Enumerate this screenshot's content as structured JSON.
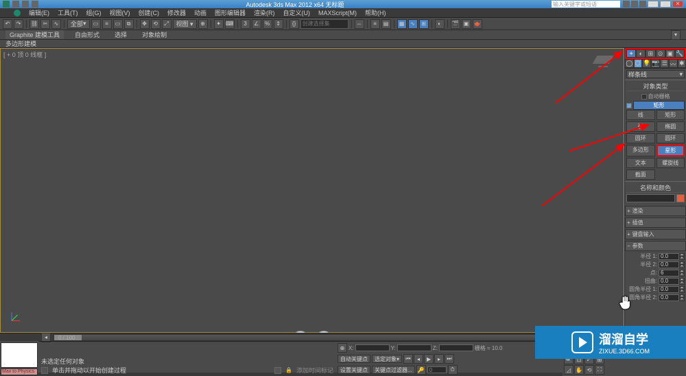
{
  "titlebar": {
    "title": "Autodesk 3ds Max  2012 x64   无标题",
    "search_placeholder": "输入关键字或短语"
  },
  "menubar": {
    "items": [
      "编辑(E)",
      "工具(T)",
      "组(G)",
      "视图(V)",
      "创建(C)",
      "修改器",
      "动画",
      "图形编辑器",
      "渲染(R)",
      "自定义(U)",
      "MAXScript(M)",
      "帮助(H)"
    ]
  },
  "toolbar": {
    "dropdown_all": "全部",
    "search_placeholder": "创建选择集"
  },
  "ribbon": {
    "tabs": [
      "Graphite 建模工具",
      "自由形式",
      "选择",
      "对象绘制"
    ]
  },
  "subribbon": {
    "label": "多边形建模"
  },
  "viewport": {
    "label": "[ + 0 顶 0 线框 ]"
  },
  "panel": {
    "dropdown": "样条线",
    "section_object_type": "对象类型",
    "autogrid": "自动栅格",
    "buttons": [
      {
        "label": "线",
        "active": false
      },
      {
        "label": "矩形",
        "active": true
      },
      {
        "label": "线",
        "active": false
      },
      {
        "label": "矩形",
        "active": false
      },
      {
        "label": "弧",
        "active": false
      },
      {
        "label": "椭圆",
        "active": false
      },
      {
        "label": "圆环",
        "active": false
      },
      {
        "label": "圆环",
        "active": false
      },
      {
        "label": "多边形",
        "active": false
      },
      {
        "label": "星形",
        "active": false,
        "hl": true
      },
      {
        "label": "文本",
        "active": false
      },
      {
        "label": "螺旋线",
        "active": false
      },
      {
        "label": "截面",
        "active": false
      }
    ],
    "section_name_color": "名称和颜色",
    "rollouts": [
      "渲染",
      "插值",
      "键盘输入"
    ],
    "params_title": "参数",
    "spinners": [
      {
        "label": "半径 1:",
        "value": "0.0"
      },
      {
        "label": "半径 2:",
        "value": "0.0"
      },
      {
        "label": "点:",
        "value": "6"
      },
      {
        "label": "扭曲:",
        "value": "0.0"
      },
      {
        "label": "圆角半径 1:",
        "value": "0.0"
      },
      {
        "label": "圆角半径 2:",
        "value": "0.0"
      }
    ]
  },
  "timeline": {
    "current": "0 / 100"
  },
  "status": {
    "selection": "未选定任何对象",
    "prompt": "单击并拖动以开始创建过程",
    "addtime": "添加时间标记",
    "grid": "栅格 = 10.0",
    "keyfilter": "关键点过滤器...",
    "auto_key": "自动关键点",
    "set_key": "设置关键点",
    "selected": "选定对象",
    "x": "",
    "y": "",
    "z": ""
  },
  "maxscript": {
    "listener": "",
    "mini": "Max to Physics t"
  },
  "watermark": {
    "cn": "溜溜自学",
    "en": "ZIXUE.3D66.COM"
  }
}
